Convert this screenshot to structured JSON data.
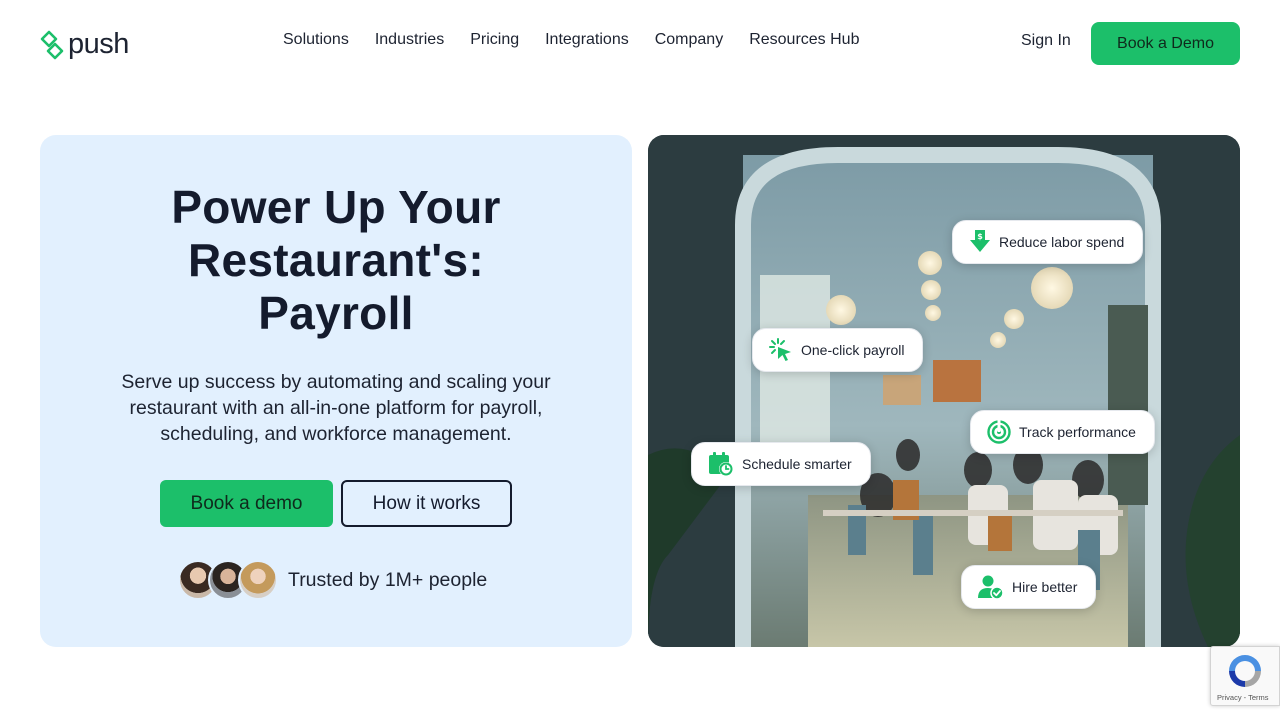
{
  "header": {
    "logo_text": "push",
    "nav": [
      "Solutions",
      "Industries",
      "Pricing",
      "Integrations",
      "Company",
      "Resources Hub"
    ],
    "sign_in": "Sign In",
    "book_demo": "Book a Demo"
  },
  "hero": {
    "title_line1": "Power Up Your",
    "title_line2": "Restaurant's:",
    "title_line3": "Payroll",
    "subtitle": "Serve up success by automating and scaling your restaurant with an all-in-one platform for payroll, scheduling, and workforce management.",
    "primary_cta": "Book a demo",
    "secondary_cta": "How it works",
    "trusted_text": "Trusted by 1M+ people"
  },
  "features": {
    "reduce_labor": "Reduce labor spend",
    "one_click_payroll": "One-click payroll",
    "track_performance": "Track performance",
    "schedule_smarter": "Schedule smarter",
    "hire_better": "Hire better"
  },
  "recaptcha": {
    "links": "Privacy - Terms"
  },
  "colors": {
    "brand_green": "#1cbf6a",
    "hero_bg": "#e2f0fe",
    "text_dark": "#141b2d"
  }
}
